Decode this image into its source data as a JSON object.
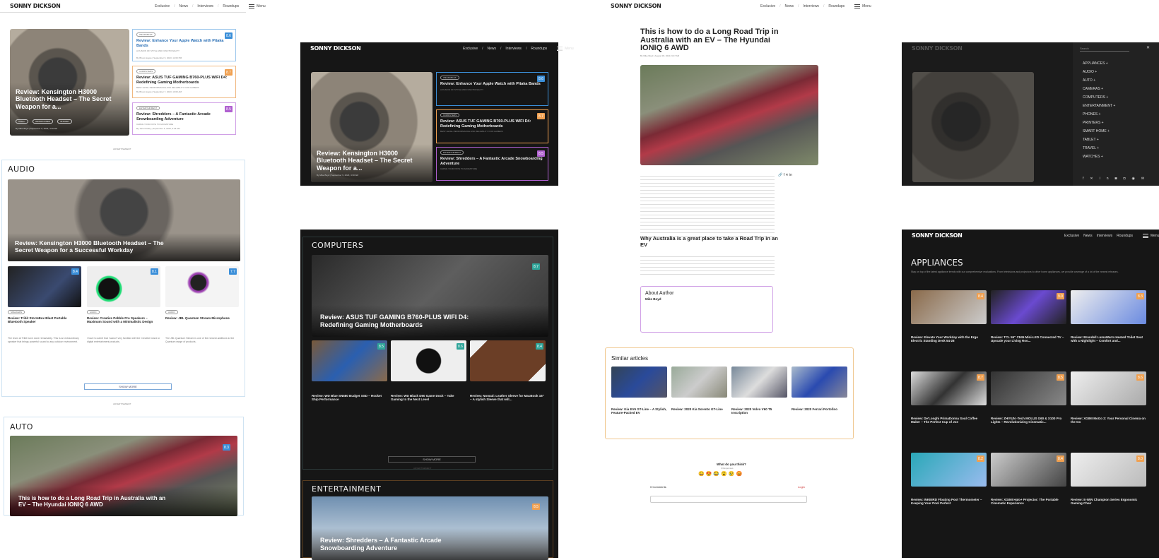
{
  "site": {
    "logo": "SONNY DICKSON",
    "nav": [
      "Exclusive",
      "News",
      "Interviews",
      "Roundups"
    ],
    "menu_label": "Menu",
    "advertisement": "ADVERTISEMENT",
    "show_more": "SHOW MORE"
  },
  "panel1": {
    "hero_title": "Review: Kensington H3000 Bluetooth Headset – The Secret Weapon for a...",
    "hero_tags": [
      "AUDIO",
      "HEADPHONES",
      "BUDGET"
    ],
    "hero_meta": "By Mike Boyd | September 9, 2023, 4:30 AM",
    "side": [
      {
        "title": "Review: Enhance Your Apple Watch with Pitaka Bands",
        "tag": "WEARABLES",
        "sub": "A FUSION OF STYLE AND FUNCTIONALITY",
        "meta": "By Bruno Hayes | September 9, 2023, 12:00 PM",
        "score": "8.6",
        "color": "#3b8fd9"
      },
      {
        "title": "Review: ASUS TUF GAMING B760-PLUS WIFI D4: Redefining Gaming Motherboards",
        "tag": "COMPUTERS",
        "sub": "BEST LEVEL PERFORMANCE AND RELIABILITY FOR GAMERS",
        "meta": "By Bruno Hayes | September 7, 2023, 10:00 AM",
        "score": "8.7",
        "color": "#f0a050"
      },
      {
        "title": "Review: Shredders – A Fantastic Arcade Snowboarding Adventure",
        "tag": "ENTERTAINMENT",
        "sub": "CARVE YOUR PATH TO ADVENTURE",
        "meta": "By Jack Gridley | September 6, 2023, 9:45 AM",
        "score": "8.5",
        "color": "#b060d0"
      }
    ]
  },
  "audio": {
    "heading": "AUDIO",
    "hero_title": "Review: Kensington H3000 Bluetooth Headset – The Secret Weapon for a Successful Workday",
    "items": [
      {
        "title": "Review: Tribit StormBox Blast Portable Bluetooth Speaker",
        "tag": "SPEAKERS",
        "score": "8.4",
        "text": "The team at Tribit have done remarkably. This is an extraordinary speaker that brings powerful sound to any outdoor environment."
      },
      {
        "title": "Review: Creative Pebble Pro Speakers – Maximum Sound with a Minimalistic Design",
        "tag": "AUDIO",
        "score": "8.1",
        "text": "I have to admit that I wasn't very familiar with the Creative brand or digital entertainment products."
      },
      {
        "title": "Review: JBL Quantum Stream Microphone",
        "tag": "AUDIO",
        "score": "7.7",
        "text": "The JBL Quantum Stream is one of the newest additions to the Quantum range of products."
      }
    ]
  },
  "auto": {
    "heading": "AUTO",
    "hero_title": "This is how to do a Long Road Trip in Australia with an EV – The Hyundai IONIQ 6 AWD",
    "score": "8.3"
  },
  "article": {
    "title": "This is how to do a Long Road Trip in Australia with an EV – The Hyundai IONIQ 6 AWD",
    "meta": "By Mike Boyd | August 30, 2023, 9:47 AM",
    "subheading": "Why Australia is a great place to take a Road Trip in an EV",
    "about_title": "About Author",
    "author": "Mike Boyd",
    "similar_heading": "Similar articles",
    "similar": [
      "Review: Kia EV6 GT-Line – A Stylish, Feature-Packed EV",
      "Review: 2020 Kia Sorento GT-Line",
      "Review: 2020 Volvo V60 T5 Inscription",
      "Review: 2020 Ferrari Portofino"
    ],
    "poll_title": "What do you think?",
    "poll_sub": "0 Responses",
    "comments_label": "0 Comments",
    "login_label": "Login"
  },
  "dark_menu": {
    "search_placeholder": "Search",
    "items": [
      "APPLIANCES",
      "AUDIO",
      "AUTO",
      "CAMERAS",
      "COMPUTERS",
      "ENTERTAINMENT",
      "PHONES",
      "PRINTERS",
      "SMART HOME",
      "TABLET",
      "TRAVEL",
      "WATCHES"
    ]
  },
  "computers": {
    "heading": "COMPUTERS",
    "hero_title": "Review: ASUS TUF GAMING B760-PLUS WIFI D4: Redefining Gaming Motherboards",
    "score": "8.7",
    "items": [
      {
        "title": "Review: WD Blue SN580 Budget SSD – Rocket Ship Performance",
        "score": "8.5"
      },
      {
        "title": "Review: WD Black D50 Game Dock – Take Gaming to the Next Level",
        "score": "8.6"
      },
      {
        "title": "Review: Nomad: Leather Sleeve for MacBook 16\" – A stylish Sleeve that will...",
        "score": "8.4"
      }
    ]
  },
  "entertainment": {
    "heading": "ENTERTAINMENT",
    "hero_title": "Review: Shredders – A Fantastic Arcade Snowboarding Adventure",
    "score": "8.5"
  },
  "appliances": {
    "heading": "APPLIANCES",
    "intro": "Stay on top of the latest appliance trends with our comprehensive evaluations. From televisions and projectors to other home appliances, we provide coverage of a lot of the newest releases.",
    "items": [
      {
        "title": "Review: Elevate Your Workday with the Ergo Electric Standing Desk 54-28",
        "score": "8.4"
      },
      {
        "title": "Review: TCL 55\" C845 Mini-LED Connected TV – Upscale your Living Roo...",
        "score": "9.0"
      },
      {
        "title": "Review: Brondell LumaWarm Heated Toilet Seat with a Nightlight – Comfort and...",
        "score": "8.3"
      },
      {
        "title": "Review: De'Longhi PrimaDonna Soul Coffee Maker – The Perfect Cup of Joe",
        "score": "8.7"
      },
      {
        "title": "Review: ZHIYUN -Tech MOLUS G60 & X100 Pro Lights – Revolutionizing Cinematic...",
        "score": "8.5"
      },
      {
        "title": "Review: XGIMI MoGo 2: Your Personal Cinema on the Go",
        "score": "8.6"
      },
      {
        "title": "Review: INKBIRD Floating Pool Thermometer – Keeping Your Pool Perfect",
        "score": "8.2"
      },
      {
        "title": "Review: XGIMI Halo+ Projector: The Portable Cinematic Experience",
        "score": "8.4"
      },
      {
        "title": "Review: E-WIN Champion Series Ergonomic Gaming Chair",
        "score": "8.0"
      }
    ]
  }
}
